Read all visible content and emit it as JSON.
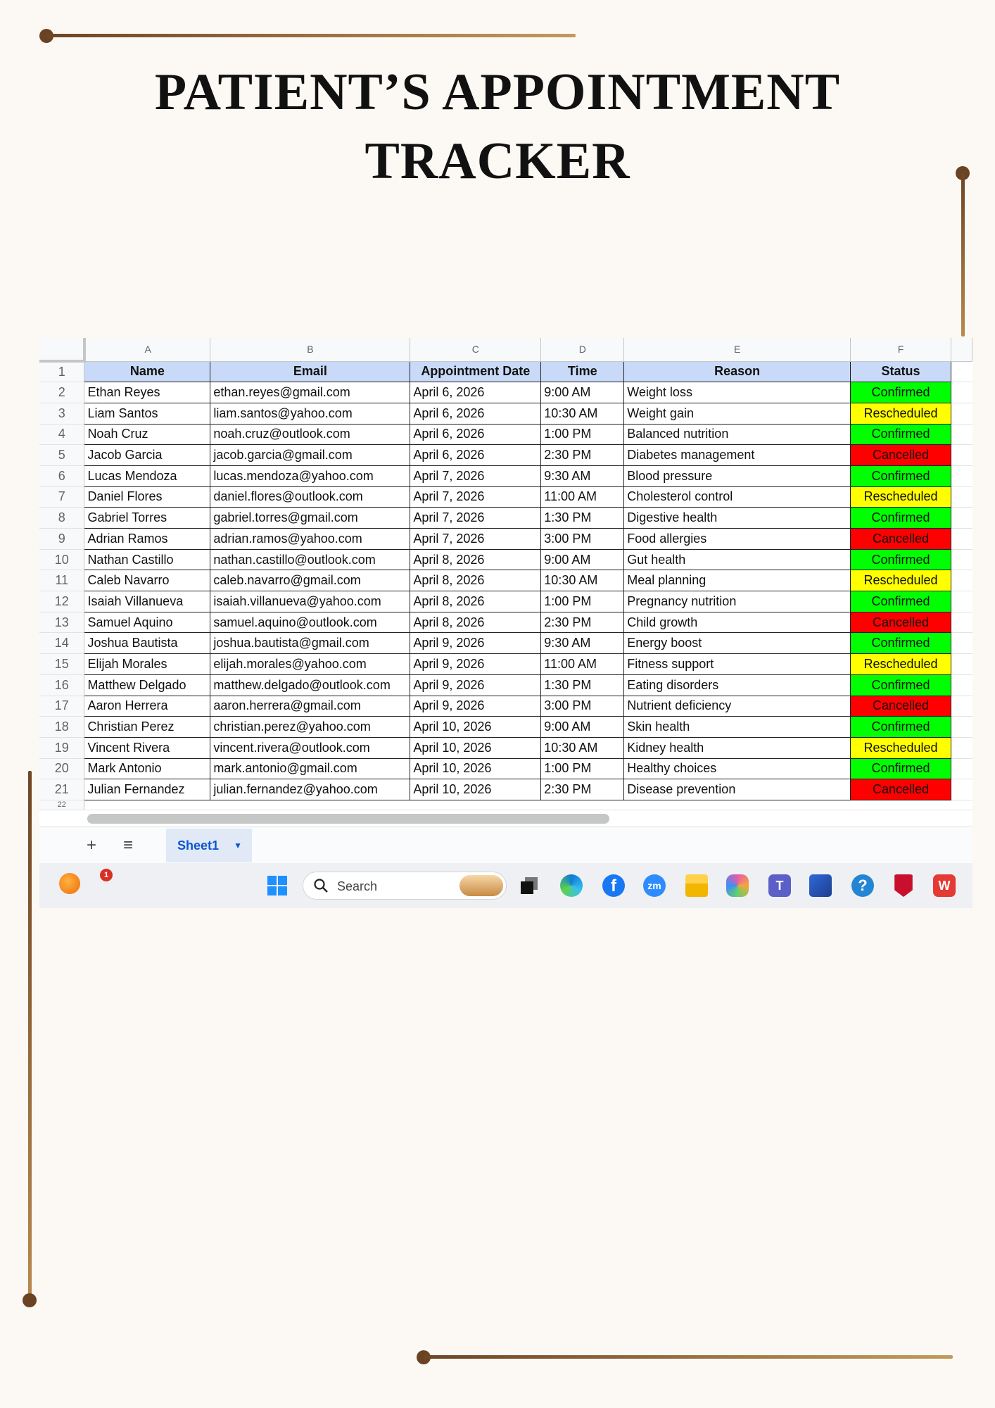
{
  "title": {
    "line1": "PATIENT’S APPOINTMENT",
    "line2": "TRACKER"
  },
  "spreadsheet": {
    "column_letters": [
      "A",
      "B",
      "C",
      "D",
      "E",
      "F"
    ],
    "headers": [
      "Name",
      "Email",
      "Appointment Date",
      "Time",
      "Reason",
      "Status"
    ],
    "rows": [
      [
        "Ethan Reyes",
        "ethan.reyes@gmail.com",
        "April 6, 2026",
        "9:00 AM",
        "Weight loss",
        "Confirmed"
      ],
      [
        "Liam Santos",
        "liam.santos@yahoo.com",
        "April 6, 2026",
        "10:30 AM",
        "Weight gain",
        "Rescheduled"
      ],
      [
        "Noah Cruz",
        "noah.cruz@outlook.com",
        "April 6, 2026",
        "1:00 PM",
        "Balanced nutrition",
        "Confirmed"
      ],
      [
        "Jacob Garcia",
        "jacob.garcia@gmail.com",
        "April 6, 2026",
        "2:30 PM",
        "Diabetes management",
        "Cancelled"
      ],
      [
        "Lucas Mendoza",
        "lucas.mendoza@yahoo.com",
        "April 7, 2026",
        "9:30 AM",
        "Blood pressure",
        "Confirmed"
      ],
      [
        "Daniel Flores",
        "daniel.flores@outlook.com",
        "April 7, 2026",
        "11:00 AM",
        "Cholesterol control",
        "Rescheduled"
      ],
      [
        "Gabriel Torres",
        "gabriel.torres@gmail.com",
        "April 7, 2026",
        "1:30 PM",
        "Digestive health",
        "Confirmed"
      ],
      [
        "Adrian Ramos",
        "adrian.ramos@yahoo.com",
        "April 7, 2026",
        "3:00 PM",
        "Food allergies",
        "Cancelled"
      ],
      [
        "Nathan Castillo",
        "nathan.castillo@outlook.com",
        "April 8, 2026",
        "9:00 AM",
        "Gut health",
        "Confirmed"
      ],
      [
        "Caleb Navarro",
        "caleb.navarro@gmail.com",
        "April 8, 2026",
        "10:30 AM",
        "Meal planning",
        "Rescheduled"
      ],
      [
        "Isaiah Villanueva",
        "isaiah.villanueva@yahoo.com",
        "April 8, 2026",
        "1:00 PM",
        "Pregnancy nutrition",
        "Confirmed"
      ],
      [
        "Samuel Aquino",
        "samuel.aquino@outlook.com",
        "April 8, 2026",
        "2:30 PM",
        "Child growth",
        "Cancelled"
      ],
      [
        "Joshua Bautista",
        "joshua.bautista@gmail.com",
        "April 9, 2026",
        "9:30 AM",
        "Energy boost",
        "Confirmed"
      ],
      [
        "Elijah Morales",
        "elijah.morales@yahoo.com",
        "April 9, 2026",
        "11:00 AM",
        "Fitness support",
        "Rescheduled"
      ],
      [
        "Matthew Delgado",
        "matthew.delgado@outlook.com",
        "April 9, 2026",
        "1:30 PM",
        "Eating disorders",
        "Confirmed"
      ],
      [
        "Aaron Herrera",
        "aaron.herrera@gmail.com",
        "April 9, 2026",
        "3:00 PM",
        "Nutrient deficiency",
        "Cancelled"
      ],
      [
        "Christian Perez",
        "christian.perez@yahoo.com",
        "April 10, 2026",
        "9:00 AM",
        "Skin health",
        "Confirmed"
      ],
      [
        "Vincent Rivera",
        "vincent.rivera@outlook.com",
        "April 10, 2026",
        "10:30 AM",
        "Kidney health",
        "Rescheduled"
      ],
      [
        "Mark Antonio",
        "mark.antonio@gmail.com",
        "April 10, 2026",
        "1:00 PM",
        "Healthy choices",
        "Confirmed"
      ],
      [
        "Julian Fernandez",
        "julian.fernandez@yahoo.com",
        "April 10, 2026",
        "2:30 PM",
        "Disease prevention",
        "Cancelled"
      ]
    ],
    "row_numbers": [
      "1",
      "2",
      "3",
      "4",
      "5",
      "6",
      "7",
      "8",
      "9",
      "10",
      "11",
      "12",
      "13",
      "14",
      "15",
      "16",
      "17",
      "18",
      "19",
      "20",
      "21",
      "22"
    ],
    "status_colors": {
      "Confirmed": "#00ff00",
      "Rescheduled": "#ffff00",
      "Cancelled": "#ff0000"
    },
    "header_color": "#c9daf8"
  },
  "sheet_tabs": {
    "add_icon": "plus-icon",
    "menu_icon": "hamburger-menu-icon",
    "active_tab": "Sheet1"
  },
  "taskbar": {
    "notification_count": "1",
    "search_placeholder": "Search",
    "icons": [
      "windows-start-icon",
      "task-view-icon",
      "edge-icon",
      "facebook-icon",
      "zoom-icon",
      "file-explorer-icon",
      "copilot-icon",
      "teams-icon",
      "store-icon",
      "help-icon",
      "mcafee-icon",
      "wps-office-icon"
    ]
  },
  "colors": {
    "page_background": "#fcf9f4",
    "accent_brown": "#6b4223",
    "accent_gold": "#c39a5c"
  }
}
